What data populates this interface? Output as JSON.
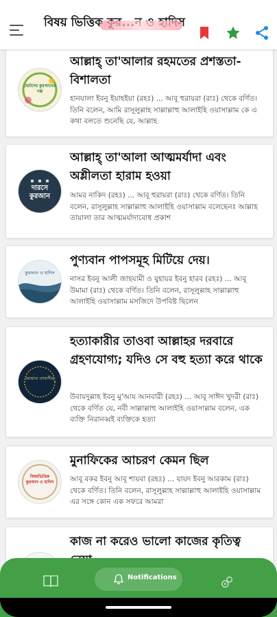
{
  "header": {
    "title": "বিষয় ভিত্তিক কুর...ন ও হাদিস"
  },
  "colors": {
    "accent_green": "#43a047",
    "bookmark_red": "#e53935",
    "star_green": "#2e9d3f",
    "share_blue": "#1e88e5"
  },
  "items": [
    {
      "title": "আল্লাহ্‌ তা'আলার রহমতের প্রশস্ততা-বিশালতা",
      "body": "হানযালা ইবনু ইয়াহইয়া (রহঃ) ... আবূ হুরায়রা (রাঃ) থেকে বর্ণিত। তিনি বলেন, আমি রাসূলুল্লাহ সাল্লাল্লাহু আলাইহি ওয়াসাল্লাম কে এ কথা বলতে শুনেছি যে, আল্লাহ",
      "thumb_text": "ছোটদের কুরআনের গল্প"
    },
    {
      "title": "আল্লাহ্‌ তা'আলা আত্মমর্যাদা এবং অশ্লীলতা হারাম হওয়া",
      "body": "আমর নাকিদ (রহঃ) ... আবূ হুরায়রা (রাঃ) থেকে বর্ণিত। তিনি বলেন, রাসূলুল্লাহ সাল্লাল্লাহু আলাইহি ওয়াসাল্লাম বলেছেনঃ আল্লাহ তায়ালা তার আত্মমর্যাদাবোধ প্রকাশ",
      "thumb_text": "দারসে কুরআন"
    },
    {
      "title": "পুণ্যবান পাপসমূহ মিটিয়ে দেয়।",
      "body": "নাসর ইবনু আলী জাহযামী ও যুহায়র ইবনু হারব (রহঃ) ... আবূ উমামা (রাঃ) থেকে বর্ণিত। তিনি বলেন, রাসূলুল্লাহ সাল্লাল্লাহু আলাইহি ওয়াসাল্লাম মসজিদে উপবিষ্ট ছিলেন",
      "thumb_text": "কুরআন ও হাদিস"
    },
    {
      "title": "হত্যাকারীর তাওবা আল্লাহর দরবারে গ্রহণযোগ্য; যদিও সে বহু হত্যা করে থাকে",
      "body": "উবায়দুল্লাহ ইবনু মু'আয আনবারী (রহঃ) ... আবূ সাঈদ খুদরী (রাঃ) থেকে বর্ণিত যে, নবী সাল্লাল্লাহু আলাইহি ওয়াসাল্লাম বলেন, এক ব্যক্তি নিরানব্বই ব্যক্তিকে হত্যা",
      "thumb_text": "আয়াত তাফসীর"
    },
    {
      "title": "মুনাফিকের আচরণ কেমন ছিল",
      "body": "আবূ বকর ইবনু আবূ শায়বা (রহঃ) ... যায়দ ইবনু আরকাম (রাঃ) থেকে বর্ণিত। তিনি বলেন, রাসূলুল্লাহ সাল্লাল্লাহু আলাইহি ওয়াসাল্লাম এর সঙ্গে কোন এক সফরে আমরা",
      "thumb_text": "বিষয়ভিত্তিক কুরআন ও হাদিস"
    },
    {
      "title": "কাজ না করেও ভালো কাজের কৃতিত্ব নেয়া",
      "body": "",
      "thumb_text": ""
    }
  ],
  "bottom_nav": {
    "notifications_label": "Notifications"
  }
}
